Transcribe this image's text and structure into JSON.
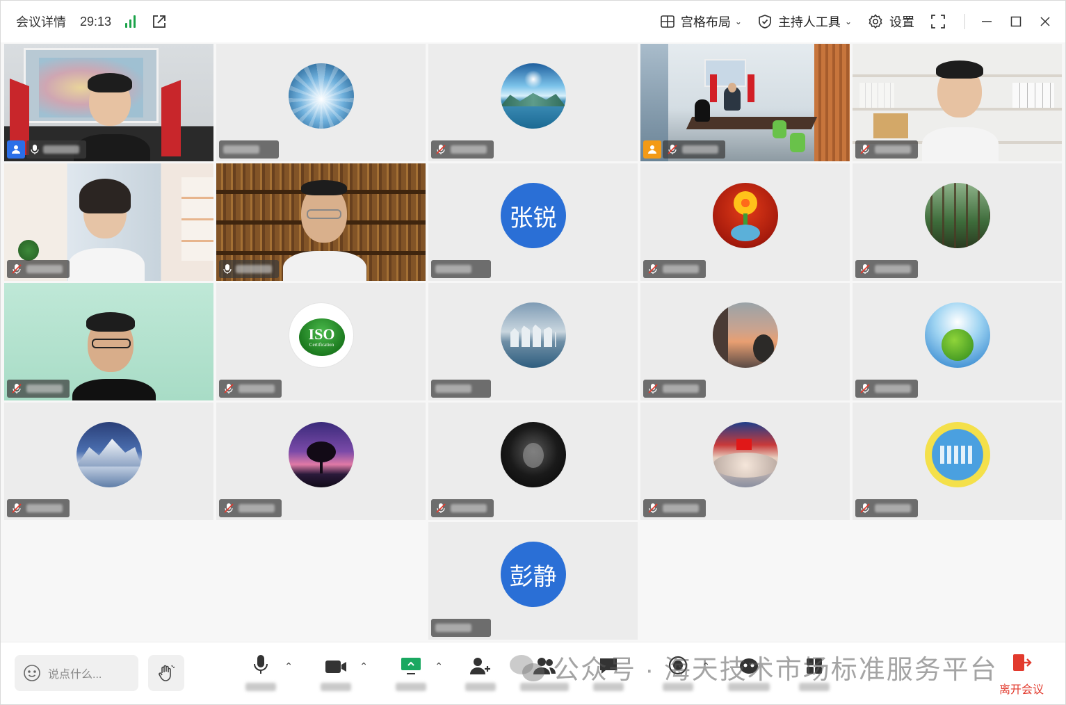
{
  "header": {
    "title": "会议详情",
    "timer": "29:13",
    "layout_label": "宫格布局",
    "host_tools_label": "主持人工具",
    "settings_label": "设置"
  },
  "participants": [
    {
      "type": "video",
      "scene": "office-map",
      "host": "blue"
    },
    {
      "type": "avatar",
      "image": "tunnel"
    },
    {
      "type": "avatar",
      "image": "lake"
    },
    {
      "type": "video",
      "scene": "meeting-room",
      "host": "orange"
    },
    {
      "type": "video",
      "scene": "bookshelf-white"
    },
    {
      "type": "video",
      "scene": "window-room"
    },
    {
      "type": "video",
      "scene": "library"
    },
    {
      "type": "avatar-text",
      "text": "张锐"
    },
    {
      "type": "avatar",
      "image": "flower"
    },
    {
      "type": "avatar",
      "image": "forest"
    },
    {
      "type": "video",
      "scene": "green-wall"
    },
    {
      "type": "avatar",
      "image": "iso"
    },
    {
      "type": "avatar",
      "image": "city-coast"
    },
    {
      "type": "avatar",
      "image": "sunset-sky"
    },
    {
      "type": "avatar",
      "image": "earth"
    },
    {
      "type": "avatar",
      "image": "snow-mountain"
    },
    {
      "type": "avatar",
      "image": "purple-tree"
    },
    {
      "type": "avatar",
      "image": "hooded"
    },
    {
      "type": "avatar",
      "image": "red-flag"
    },
    {
      "type": "avatar",
      "image": "people-circle"
    },
    {
      "type": "avatar-text",
      "text": "彭静"
    }
  ],
  "iso_badge": {
    "line1": "ISO",
    "line2": "Certification"
  },
  "toolbar": {
    "chat_placeholder": "说点什么...",
    "leave_label": "离开会议"
  },
  "watermark": "公众号 · 海天技术市场标准服务平台",
  "colors": {
    "accent": "#2a6fd6",
    "signal": "#1ba34a",
    "leave": "#e23a2d",
    "host_blue": "#2b6fe8",
    "host_orange": "#f39a16"
  }
}
